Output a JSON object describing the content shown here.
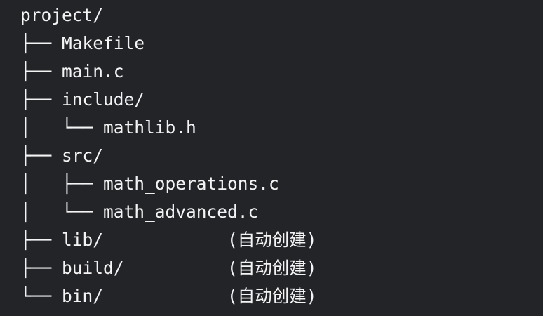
{
  "tree": {
    "lines": [
      {
        "text": "project/",
        "note": ""
      },
      {
        "text": "├── Makefile",
        "note": ""
      },
      {
        "text": "├── main.c",
        "note": ""
      },
      {
        "text": "├── include/",
        "note": ""
      },
      {
        "text": "│   └── mathlib.h",
        "note": ""
      },
      {
        "text": "├── src/",
        "note": ""
      },
      {
        "text": "│   ├── math_operations.c",
        "note": ""
      },
      {
        "text": "│   └── math_advanced.c",
        "note": ""
      },
      {
        "text": "├── lib/            ",
        "note": "(自动创建)"
      },
      {
        "text": "├── build/          ",
        "note": "(自动创建)"
      },
      {
        "text": "└── bin/            ",
        "note": "(自动创建)"
      }
    ]
  }
}
